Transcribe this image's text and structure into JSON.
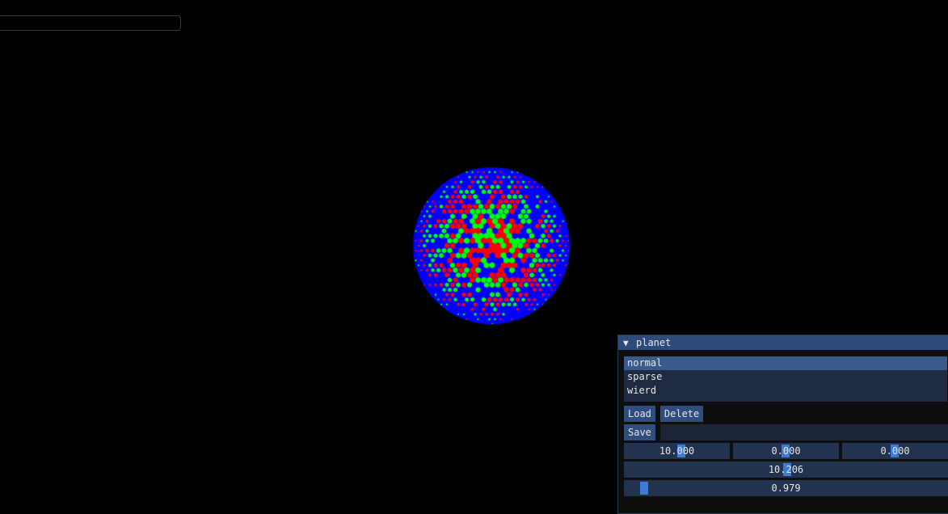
{
  "panel": {
    "title": "planet",
    "presets": [
      "normal",
      "sparse",
      "wierd"
    ],
    "selected_preset": "normal",
    "load_label": "Load",
    "delete_label": "Delete",
    "save_label": "Save",
    "name_value": "",
    "position": {
      "x": "10.000",
      "y": "0.000",
      "z": "0.000"
    },
    "radius": "10.206",
    "density": "0.979"
  },
  "colors": {
    "background": "#000000",
    "panel_title_bg": "#2c4a7c",
    "slider_grab": "#3d7bd6",
    "planet_red": "#ff0000",
    "planet_green": "#00ff00",
    "planet_blue": "#0000ff"
  },
  "icons": {
    "collapse": "triangle-down-icon"
  }
}
